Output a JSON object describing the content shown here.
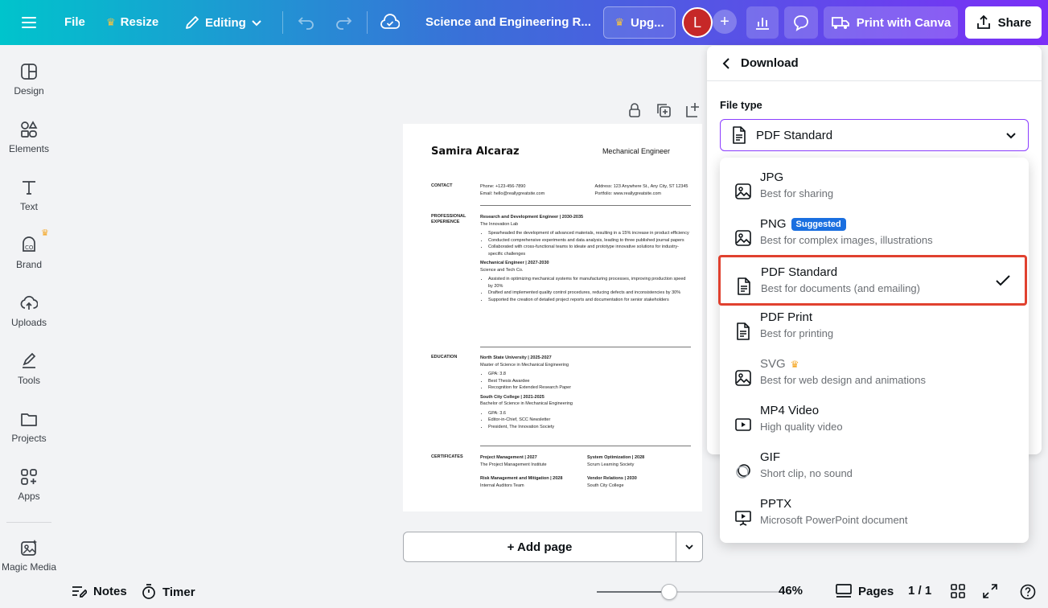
{
  "topbar": {
    "file": "File",
    "resize": "Resize",
    "editing": "Editing",
    "doc_title": "Science and Engineering R...",
    "upgrade": "Upg...",
    "avatar_initial": "L",
    "print": "Print with Canva",
    "share": "Share"
  },
  "sidebar": {
    "items": [
      {
        "label": "Design",
        "icon": "layout-icon"
      },
      {
        "label": "Elements",
        "icon": "shapes-icon"
      },
      {
        "label": "Text",
        "icon": "text-icon"
      },
      {
        "label": "Brand",
        "icon": "brand-icon"
      },
      {
        "label": "Uploads",
        "icon": "upload-cloud-icon"
      },
      {
        "label": "Tools",
        "icon": "pen-icon"
      },
      {
        "label": "Projects",
        "icon": "folder-icon"
      },
      {
        "label": "Apps",
        "icon": "apps-icon"
      },
      {
        "label": "Magic Media",
        "icon": "magic-media-icon"
      }
    ]
  },
  "resume": {
    "name": "Samira Alcaraz",
    "title": "Mechanical Engineer",
    "contact_label": "CONTACT",
    "phone": "Phone: +123-456-7890",
    "email": "Email: hello@reallygreatsite.com",
    "address": "Address: 123 Anywhere St., Any City, ST 12345",
    "portfolio": "Portfolio: www.reallygreatsite.com",
    "exp_label": "PROFESSIONAL EXPERIENCE",
    "job1_title": "Research and Development Engineer | 2030-2035",
    "job1_company": "The Innovation Lab",
    "job1_b1": "Spearheaded the development of advanced materials, resulting in a 15% increase in product efficiency",
    "job1_b2": "Conducted comprehensive experiments and data analysis, leading to three published journal papers",
    "job1_b3": "Collaborated with cross-functional teams to ideate and prototype innovative solutions for industry-specific challenges",
    "job2_title": "Mechanical Engineer | 2027-2030",
    "job2_company": "Science and Tech Co.",
    "job2_b1": "Assisted in optimizing mechanical systems for manufacturing processes, improving production speed by 20%",
    "job2_b2": "Drafted and implemented quality control procedures, reducing defects and inconsistencies by 30%",
    "job2_b3": "Supported the creation of detailed project reports and documentation for senior stakeholders",
    "edu_label": "EDUCATION",
    "edu1_title": "North State University | 2025-2027",
    "edu1_degree": "Master of Science in Mechanical Engineering",
    "edu1_b1": "GPA: 3.8",
    "edu1_b2": "Best Thesis Awardee",
    "edu1_b3": "Recognition for Extended Research Paper",
    "edu2_title": "South City College | 2021-2025",
    "edu2_degree": "Bachelor of Science in Mechanical Engineering",
    "edu2_b1": "GPA: 3.6",
    "edu2_b2": "Editor-in-Chief, SCC Newsletter",
    "edu2_b3": "President, The Innovation Society",
    "cert_label": "CERTIFICATES",
    "cert1_title": "Project Management | 2027",
    "cert1_org": "The Project Management Institute",
    "cert2_title": "System Optimization | 2028",
    "cert2_org": "Scrum Learning Society",
    "cert3_title": "Risk Management and Mitigation | 2028",
    "cert3_org": "Internal Auditors Team",
    "cert4_title": "Vendor Relations | 2030",
    "cert4_org": "South City College"
  },
  "canvas": {
    "add_page": "+ Add page"
  },
  "bottombar": {
    "notes": "Notes",
    "timer": "Timer",
    "zoom": "46%",
    "zoom_fraction": 0.46,
    "pages": "Pages",
    "page_count": "1 / 1"
  },
  "download": {
    "title": "Download",
    "file_type_label": "File type",
    "selected": "PDF Standard",
    "options": [
      {
        "name": "JPG",
        "desc": "Best for sharing",
        "icon": "image-icon"
      },
      {
        "name": "PNG",
        "desc": "Best for complex images, illustrations",
        "badge": "Suggested",
        "icon": "image-icon"
      },
      {
        "name": "PDF Standard",
        "desc": "Best for documents (and emailing)",
        "icon": "document-icon",
        "selected": true
      },
      {
        "name": "PDF Print",
        "desc": "Best for printing",
        "icon": "document-icon"
      },
      {
        "name": "SVG",
        "desc": "Best for web design and animations",
        "icon": "image-icon",
        "premium": true
      },
      {
        "name": "MP4 Video",
        "desc": "High quality video",
        "icon": "video-icon"
      },
      {
        "name": "GIF",
        "desc": "Short clip, no sound",
        "icon": "gif-icon"
      },
      {
        "name": "PPTX",
        "desc": "Microsoft PowerPoint document",
        "icon": "presentation-icon"
      }
    ]
  },
  "colors": {
    "accent": "#8b3dff",
    "selection_outline": "#e0412f",
    "badge": "#1a6fe0",
    "avatar": "#c62828",
    "crown": "#f5a623"
  }
}
